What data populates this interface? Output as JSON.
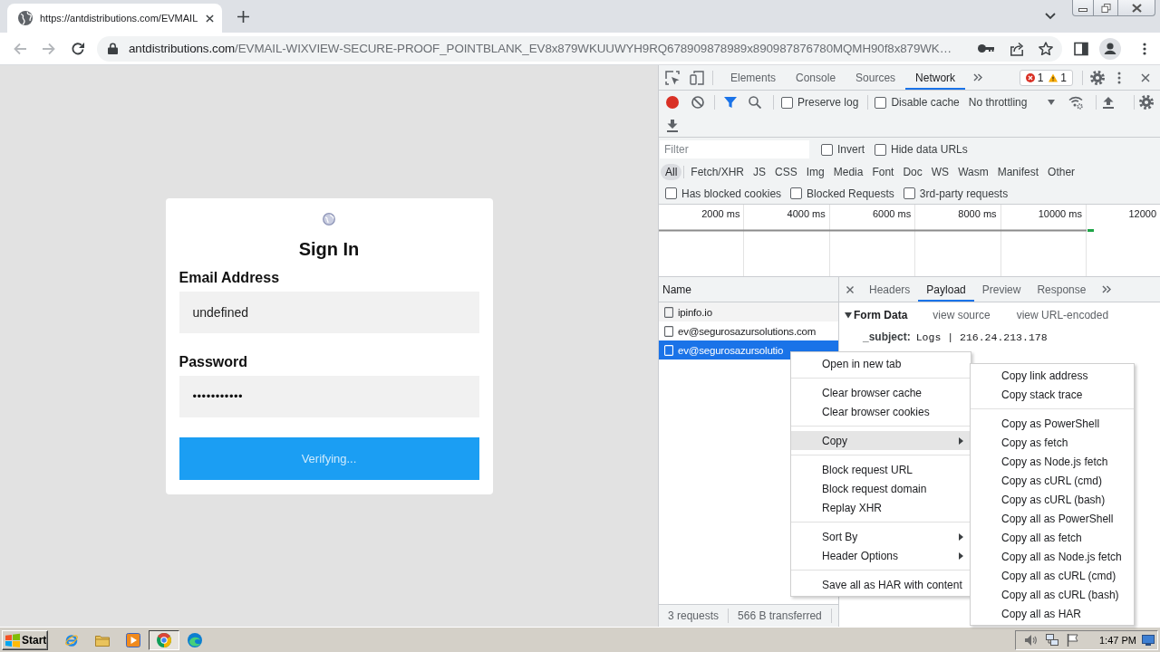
{
  "browser": {
    "tabs": [
      {
        "title": "https://antdistributions.com/EVMAIL",
        "selected": true
      }
    ],
    "back": {
      "disabled": true
    },
    "forward": {
      "disabled": true
    },
    "address": {
      "host": "antdistributions.com",
      "path": "/EVMAIL-WIXVIEW-SECURE-PROOF_POINTBLANK_EV8x879WKUUWYH9RQ678909878989x890987876780MQMH90f8x879WK…"
    }
  },
  "page": {
    "title": "Sign In",
    "fields": [
      {
        "label": "Email Address",
        "value": "undefined"
      },
      {
        "label": "Password",
        "value": "•••••••••••"
      }
    ],
    "button": "Verifying..."
  },
  "devtools": {
    "tabs": [
      {
        "label": "Elements",
        "selected": false
      },
      {
        "label": "Console",
        "selected": false
      },
      {
        "label": "Sources",
        "selected": false
      },
      {
        "label": "Network",
        "selected": true
      }
    ],
    "issues": {
      "errors": "1",
      "warnings": "1"
    },
    "toolbar": {
      "recording": true,
      "filter_shown": true,
      "options": [
        {
          "label": "Preserve log",
          "checked": false
        },
        {
          "label": "Disable cache",
          "checked": false
        }
      ],
      "throttling": "No throttling"
    },
    "filter": {
      "placeholder": "Filter",
      "options": [
        {
          "label": "Invert",
          "checked": false
        },
        {
          "label": "Hide data URLs",
          "checked": false
        }
      ]
    },
    "types": [
      {
        "label": "All",
        "selected": true
      },
      {
        "label": "Fetch/XHR",
        "selected": false
      },
      {
        "label": "JS",
        "selected": false
      },
      {
        "label": "CSS",
        "selected": false
      },
      {
        "label": "Img",
        "selected": false
      },
      {
        "label": "Media",
        "selected": false
      },
      {
        "label": "Font",
        "selected": false
      },
      {
        "label": "Doc",
        "selected": false
      },
      {
        "label": "WS",
        "selected": false
      },
      {
        "label": "Wasm",
        "selected": false
      },
      {
        "label": "Manifest",
        "selected": false
      },
      {
        "label": "Other",
        "selected": false
      }
    ],
    "extra_filters": [
      {
        "label": "Has blocked cookies",
        "checked": false
      },
      {
        "label": "Blocked Requests",
        "checked": false
      },
      {
        "label": "3rd-party requests",
        "checked": false
      }
    ],
    "overview": {
      "ticks": [
        "2000 ms",
        "4000 ms",
        "6000 ms",
        "8000 ms",
        "10000 ms",
        "12000"
      ]
    },
    "requests": {
      "header": "Name",
      "rows": [
        {
          "name": "ipinfo.io",
          "selected": false
        },
        {
          "name": "ev@segurosazursolutions.com",
          "selected": false
        },
        {
          "name": "ev@segurosazursolutio",
          "selected": true
        }
      ],
      "summary": [
        "3 requests",
        "566 B transferred"
      ]
    },
    "details": {
      "tabs": [
        {
          "label": "Headers",
          "selected": false
        },
        {
          "label": "Payload",
          "selected": true
        },
        {
          "label": "Preview",
          "selected": false
        },
        {
          "label": "Response",
          "selected": false
        }
      ],
      "section": {
        "title": "Form Data",
        "expanded": true,
        "links": [
          "view source",
          "view URL-encoded"
        ],
        "fields": [
          {
            "key": "_subject:",
            "value": "Logs | 216.24.213.178"
          }
        ]
      }
    }
  },
  "context_menu": {
    "groups": [
      [
        {
          "label": "Open in new tab",
          "selected": false,
          "has_submenu": false
        }
      ],
      [
        {
          "label": "Clear browser cache",
          "selected": false,
          "has_submenu": false
        },
        {
          "label": "Clear browser cookies",
          "selected": false,
          "has_submenu": false
        }
      ],
      [
        {
          "label": "Copy",
          "selected": true,
          "has_submenu": true
        }
      ],
      [
        {
          "label": "Block request URL",
          "selected": false,
          "has_submenu": false
        },
        {
          "label": "Block request domain",
          "selected": false,
          "has_submenu": false
        },
        {
          "label": "Replay XHR",
          "selected": false,
          "has_submenu": false
        }
      ],
      [
        {
          "label": "Sort By",
          "selected": false,
          "has_submenu": true
        },
        {
          "label": "Header Options",
          "selected": false,
          "has_submenu": true
        }
      ],
      [
        {
          "label": "Save all as HAR with content",
          "selected": false,
          "has_submenu": false
        }
      ]
    ]
  },
  "submenu": {
    "groups": [
      [
        "Copy link address",
        "Copy stack trace"
      ],
      [
        "Copy as PowerShell",
        "Copy as fetch",
        "Copy as Node.js fetch",
        "Copy as cURL (cmd)",
        "Copy as cURL (bash)",
        "Copy all as PowerShell",
        "Copy all as fetch",
        "Copy all as Node.js fetch",
        "Copy all as cURL (cmd)",
        "Copy all as cURL (bash)",
        "Copy all as HAR"
      ]
    ]
  },
  "taskbar": {
    "start": "Start",
    "apps": [
      {
        "selected": false
      },
      {
        "selected": false
      },
      {
        "selected": false
      },
      {
        "selected": true
      },
      {
        "selected": false
      }
    ],
    "clock": "1:47 PM"
  }
}
